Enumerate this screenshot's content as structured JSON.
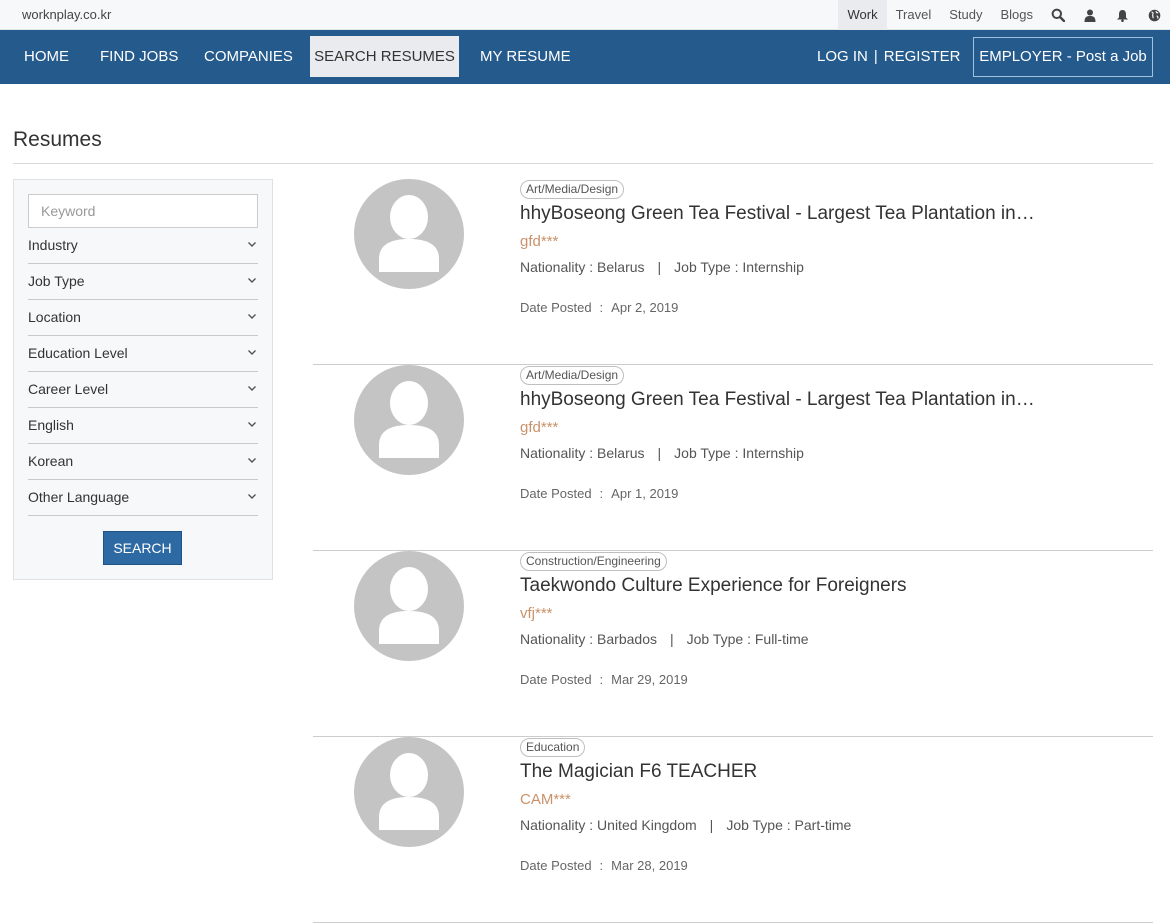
{
  "topbar": {
    "site": "worknplay.co.kr",
    "links": [
      "Work",
      "Travel",
      "Study",
      "Blogs"
    ],
    "icons": [
      "search-icon",
      "user-icon",
      "bell-icon",
      "globe-icon"
    ]
  },
  "nav": {
    "items": [
      "HOME",
      "FIND JOBS",
      "COMPANIES",
      "SEARCH RESUMES",
      "MY RESUME"
    ],
    "login": "LOG IN",
    "separator": "|",
    "register": "REGISTER",
    "employer": "EMPLOYER - Post a Job"
  },
  "page": {
    "title": "Resumes"
  },
  "sidebar": {
    "keyword_placeholder": "Keyword",
    "filters": [
      "Industry",
      "Job Type",
      "Location",
      "Education Level",
      "Career Level",
      "English",
      "Korean",
      "Other Language"
    ],
    "search_label": "SEARCH"
  },
  "labels": {
    "nationality": "Nationality :",
    "job_type": "Job Type :",
    "date_posted": "Date Posted",
    "pipe": "|",
    "colon": ":"
  },
  "resumes": [
    {
      "category": "Art/Media/Design",
      "title": "hhyBoseong Green Tea Festival - Largest Tea Plantation in…",
      "name": "gfd***",
      "nationality": "Belarus",
      "job_type": "Internship",
      "date": "Apr 2, 2019"
    },
    {
      "category": "Art/Media/Design",
      "title": "hhyBoseong Green Tea Festival - Largest Tea Plantation in…",
      "name": "gfd***",
      "nationality": "Belarus",
      "job_type": "Internship",
      "date": "Apr 1, 2019"
    },
    {
      "category": "Construction/Engineering",
      "title": "Taekwondo Culture Experience for Foreigners",
      "name": "vfj***",
      "nationality": "Barbados",
      "job_type": "Full-time",
      "date": "Mar 29, 2019"
    },
    {
      "category": "Education",
      "title": "The Magician F6 TEACHER",
      "name": "CAM***",
      "nationality": "United Kingdom",
      "job_type": "Part-time",
      "date": "Mar 28, 2019"
    }
  ],
  "colors": {
    "nav_bg": "#255a8c",
    "button": "#2d6aa3",
    "name_accent": "#c9926a",
    "avatar": "#c4c4c4"
  }
}
